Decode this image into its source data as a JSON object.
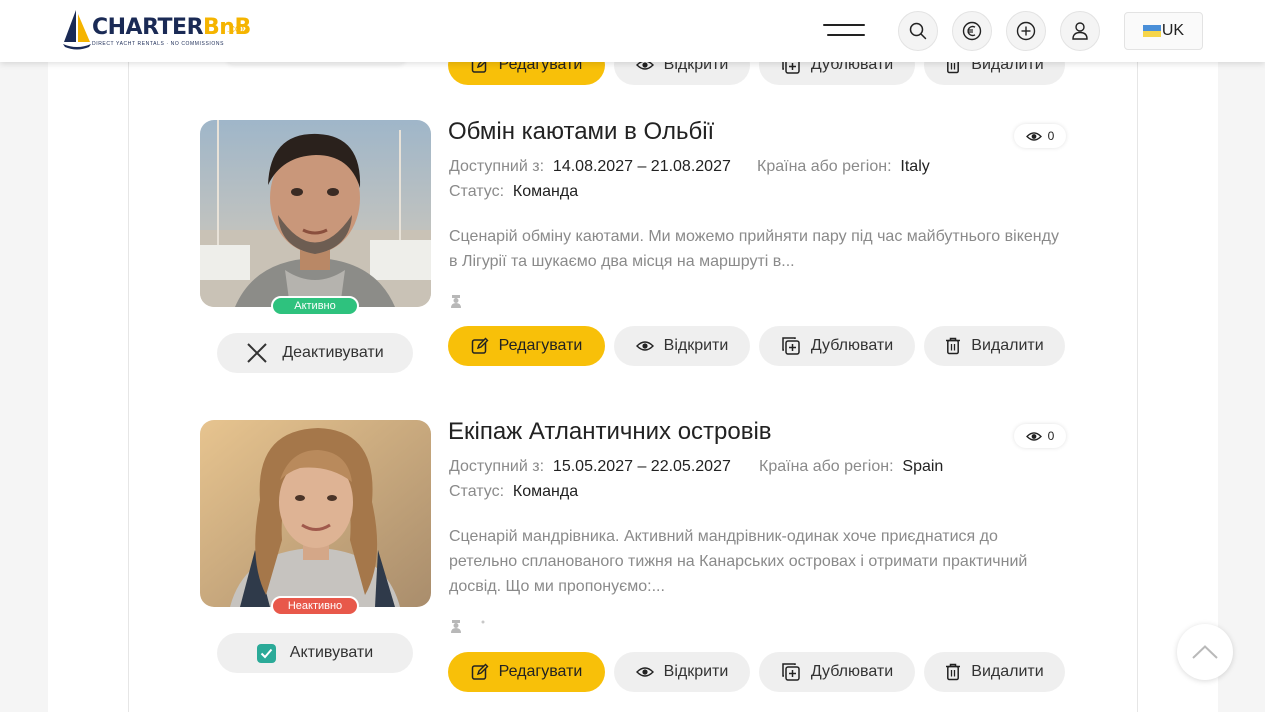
{
  "brand": {
    "name_part1": "CHARTER",
    "name_part2": "BnB",
    "suffix": ".COM",
    "tagline": "DIRECT YACHT RENTALS · NO COMMISSIONS"
  },
  "header": {
    "language_label": "UK",
    "icons": [
      "menu-icon",
      "search-icon",
      "euro-icon",
      "add-icon",
      "user-icon"
    ]
  },
  "top_partial_actions": {
    "edit": "Редагувати",
    "open": "Відкрити",
    "duplicate": "Дублювати",
    "delete": "Видалити"
  },
  "listings": [
    {
      "title": "Обмін каютами в Ольбії",
      "available_label": "Доступний з:",
      "available_value": "14.08.2027 – 21.08.2027",
      "region_label": "Країна або регіон:",
      "region_value": "Italy",
      "status_label": "Статус:",
      "status_value": "Команда",
      "description": "Сценарій обміну каютами. Ми можемо прийняти пару під час майбутнього вікенду в Лігурії та шукаємо два місця на маршруті в...",
      "views": "0",
      "state_badge": "Активно",
      "toggle_label": "Деактивувати",
      "actions": {
        "edit": "Редагувати",
        "open": "Відкрити",
        "duplicate": "Дублювати",
        "delete": "Видалити"
      }
    },
    {
      "title": "Екіпаж Атлантичних островів",
      "available_label": "Доступний з:",
      "available_value": "15.05.2027 – 22.05.2027",
      "region_label": "Країна або регіон:",
      "region_value": "Spain",
      "status_label": "Статус:",
      "status_value": "Команда",
      "description": "Сценарій мандрівника. Активний мандрівник-одинак хоче приєднатися до ретельно спланованого тижня на Канарських островах і отримати практичний досвід. Що ми пропонуємо:...",
      "views": "0",
      "state_badge": "Неактивно",
      "toggle_label": "Активувати",
      "actions": {
        "edit": "Редагувати",
        "open": "Відкрити",
        "duplicate": "Дублювати",
        "delete": "Видалити"
      }
    }
  ],
  "colors": {
    "accent_yellow": "#f8c009",
    "active_green": "#2ec27e",
    "inactive_red": "#e8584a",
    "check_teal": "#2baa98"
  }
}
